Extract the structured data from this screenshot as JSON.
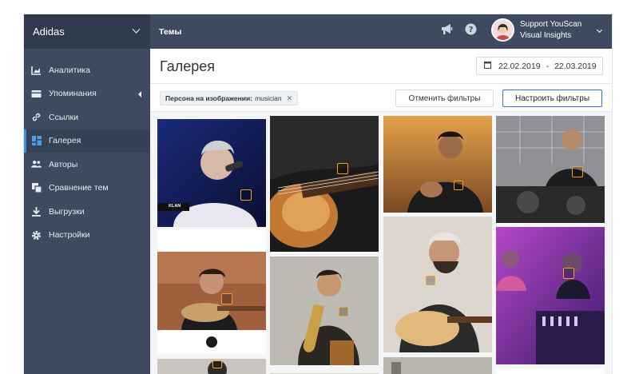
{
  "sidebar": {
    "brand": "Adidas",
    "items": [
      {
        "label": "Аналитика",
        "icon": "chart-icon"
      },
      {
        "label": "Упоминания",
        "icon": "mentions-icon"
      },
      {
        "label": "Ссылки",
        "icon": "link-icon"
      },
      {
        "label": "Галерея",
        "icon": "gallery-icon",
        "active": true
      },
      {
        "label": "Авторы",
        "icon": "authors-icon"
      },
      {
        "label": "Сравнение тем",
        "icon": "compare-icon"
      },
      {
        "label": "Выгрузки",
        "icon": "download-icon"
      },
      {
        "label": "Настройки",
        "icon": "gear-icon"
      }
    ]
  },
  "topbar": {
    "section": "Темы",
    "user_name": "Support YouScan",
    "user_subtitle": "Visual Insights"
  },
  "page": {
    "title": "Галерея",
    "date_from": "22.02.2019",
    "date_to": "22.03.2019"
  },
  "filters": {
    "chip_key": "Персона на изображении:",
    "chip_value": "musician",
    "reset_label": "Отменить фильтры",
    "configure_label": "Настроить фильтры"
  },
  "gallery": {
    "tile1_overlay": "KLAN"
  },
  "colors": {
    "sidebar": "#3d4a5f",
    "brand_bar": "#2f3a4d",
    "accent": "#3b8ee6",
    "badge": "#f2a120"
  }
}
